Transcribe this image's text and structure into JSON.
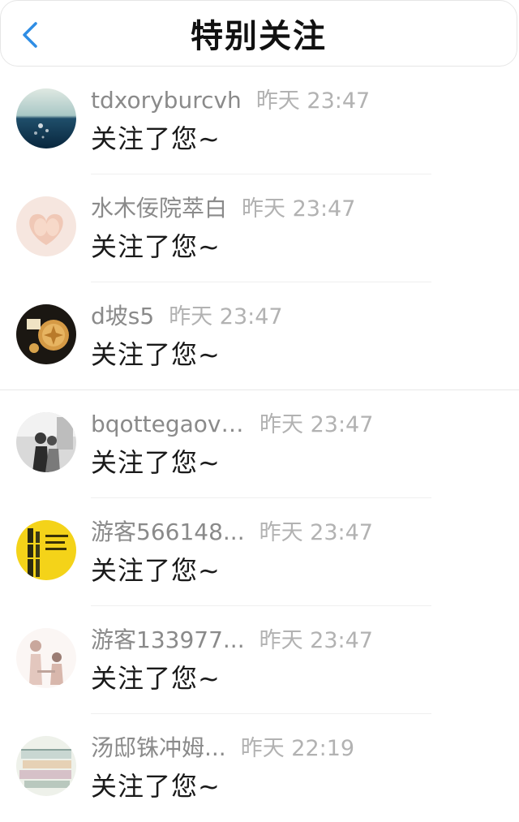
{
  "header": {
    "back_icon": "chevron-left-icon",
    "title": "特别关注"
  },
  "colors": {
    "accent": "#2f8de4",
    "name_text": "#8a8a8a",
    "time_text": "#b2b2b2"
  },
  "items": [
    {
      "name": "tdxoryburcvh",
      "time": "昨天 23:47",
      "message": "关注了您~",
      "avatar": "ocean-sunset-avatar"
    },
    {
      "name": "水木佞院萃白",
      "time": "昨天 23:47",
      "message": "关注了您~",
      "avatar": "baby-feet-heart-avatar"
    },
    {
      "name": "d坡s5",
      "time": "昨天 23:47",
      "message": "关注了您~",
      "avatar": "mooncake-avatar"
    },
    {
      "name": "bqottegaove...",
      "time": "昨天 23:47",
      "message": "关注了您~",
      "avatar": "couple-bw-avatar"
    },
    {
      "name": "游客566148...",
      "time": "昨天 23:47",
      "message": "关注了您~",
      "avatar": "yellow-bamboo-avatar"
    },
    {
      "name": "游客133977...",
      "time": "昨天 23:47",
      "message": "关注了您~",
      "avatar": "couple-illustration-avatar"
    },
    {
      "name": "汤邸铢冲姆...",
      "time": "昨天 22:19",
      "message": "关注了您~",
      "avatar": "books-avatar"
    }
  ]
}
